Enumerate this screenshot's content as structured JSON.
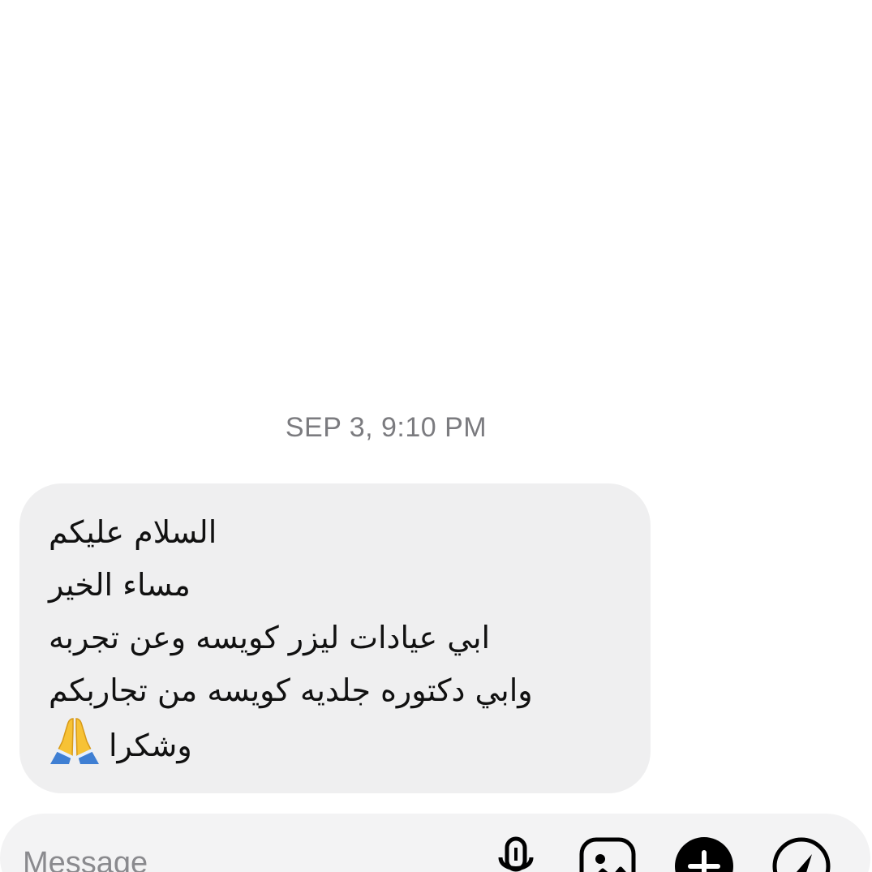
{
  "thread": {
    "timestamp": "SEP 3, 9:10 PM",
    "message": {
      "lines": [
        "السلام عليكم",
        "مساء الخير",
        "ابي عيادات ليزر كويسه وعن تجربه",
        "وابي دكتوره جلديه كويسه من تجاربكم",
        "وشكرا"
      ],
      "emoji": "folded-hands"
    }
  },
  "composer": {
    "placeholder": "Message",
    "icons": [
      "microphone-icon",
      "gallery-icon",
      "plus-icon",
      "sticker-icon"
    ]
  },
  "colors": {
    "bubble_bg": "#efeff0",
    "composer_bg": "#f3f3f4",
    "timestamp": "#7b7b7f",
    "text": "#111111",
    "icon": "#000000"
  }
}
